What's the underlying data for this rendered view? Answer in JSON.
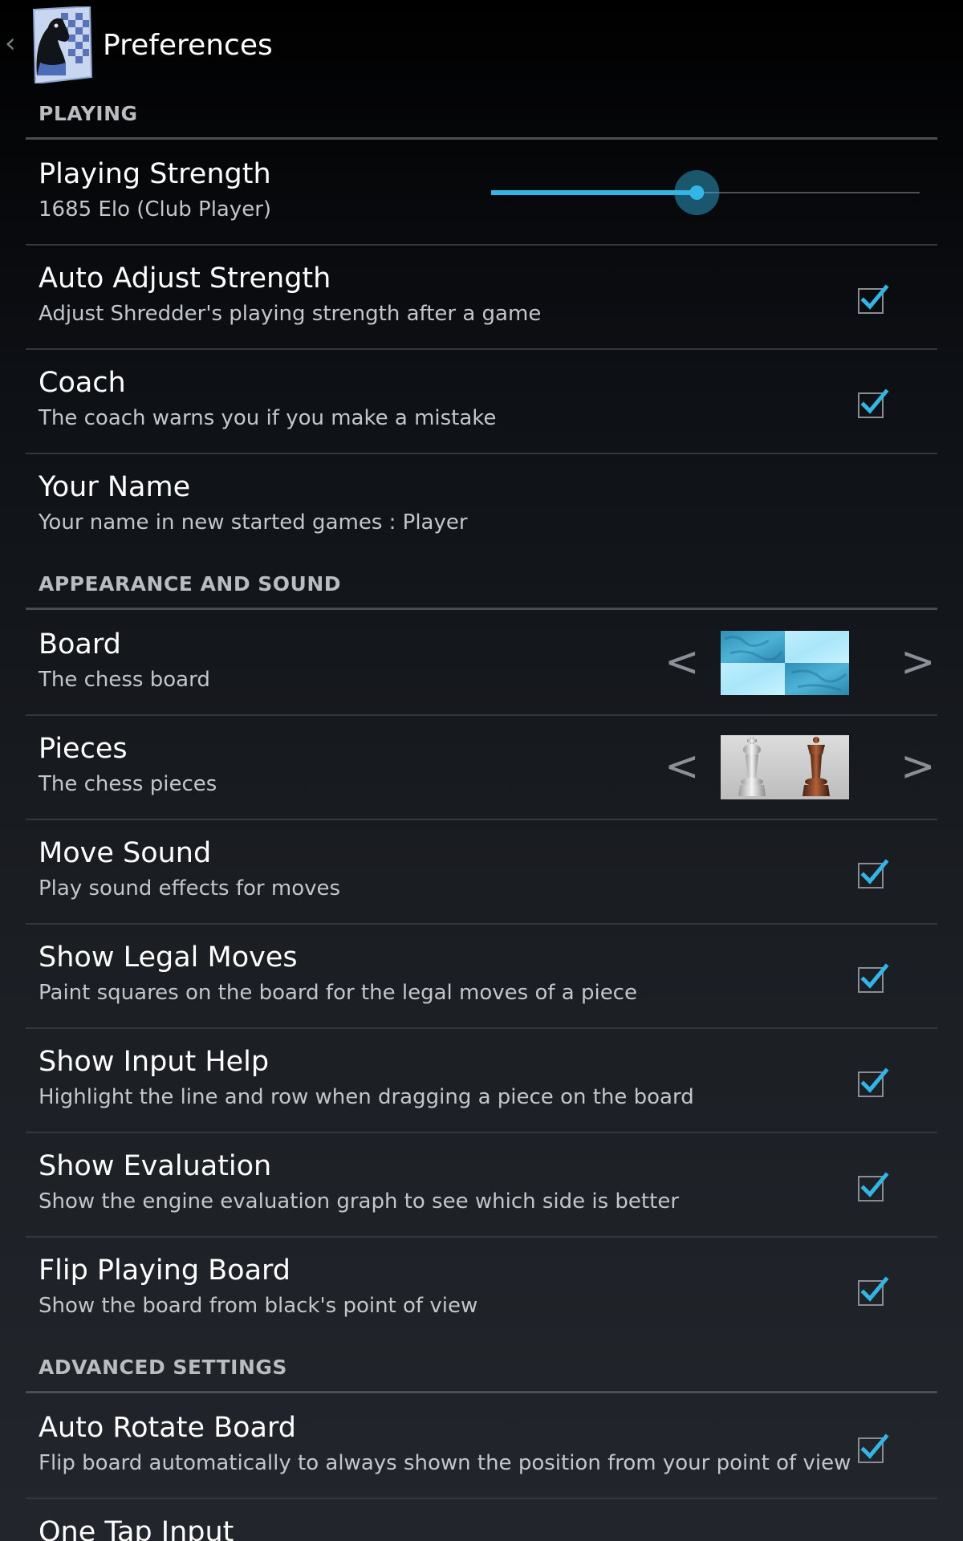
{
  "actionbar": {
    "title": "Preferences",
    "up_icon": "chevron-left-icon",
    "app_icon": "chess-knight-app-icon"
  },
  "sections": {
    "playing": "PLAYING",
    "appearance": "APPEARANCE AND SOUND",
    "advanced": "ADVANCED SETTINGS"
  },
  "prefs": {
    "playing_strength": {
      "title": "Playing Strength",
      "summary": "1685 Elo (Club Player)",
      "slider_value": 0.48
    },
    "auto_adjust": {
      "title": "Auto Adjust Strength",
      "summary": "Adjust Shredder's playing strength after a game",
      "checked": true
    },
    "coach": {
      "title": "Coach",
      "summary": "The coach warns you if you make a mistake",
      "checked": true
    },
    "your_name": {
      "title": "Your Name",
      "summary": "Your name in new started games : Player"
    },
    "board": {
      "title": "Board",
      "summary": "The chess board",
      "prev": "<",
      "next": ">"
    },
    "pieces": {
      "title": "Pieces",
      "summary": "The chess pieces",
      "prev": "<",
      "next": ">"
    },
    "move_sound": {
      "title": "Move Sound",
      "summary": "Play sound effects for moves",
      "checked": true
    },
    "show_legal_moves": {
      "title": "Show Legal Moves",
      "summary": "Paint squares on the board for the legal moves of a piece",
      "checked": true
    },
    "show_input_help": {
      "title": "Show Input Help",
      "summary": "Highlight the line and row when dragging a piece on the board",
      "checked": true
    },
    "show_evaluation": {
      "title": "Show Evaluation",
      "summary": "Show the engine evaluation graph to see which side is better",
      "checked": true
    },
    "flip_board": {
      "title": "Flip Playing Board",
      "summary": "Show the board from black's point of view",
      "checked": true
    },
    "auto_rotate": {
      "title": "Auto Rotate Board",
      "summary": "Flip board automatically to always shown the position from your point of view",
      "checked": true
    },
    "one_tap": {
      "title": "One Tap Input"
    }
  },
  "colors": {
    "accent": "#33b5e5",
    "checkbox_border": "#8a8d91"
  }
}
